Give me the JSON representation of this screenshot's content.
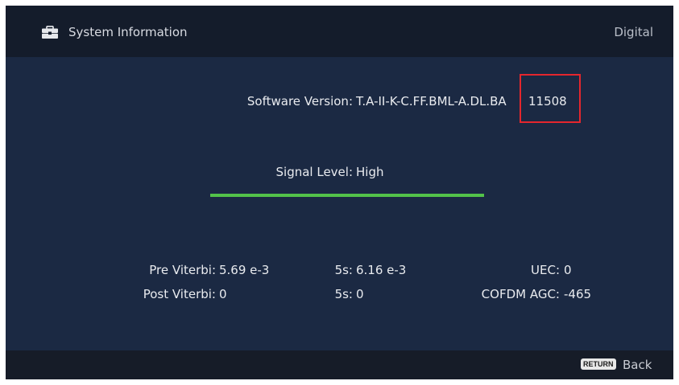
{
  "header": {
    "icon": "toolbox-icon",
    "title": "System Information",
    "mode": "Digital"
  },
  "software": {
    "label": "Software Version:",
    "value": "T.A-II-K-C.FF.BML-A.DL.BA",
    "build": "11508"
  },
  "signal": {
    "label": "Signal Level:",
    "value": "High",
    "level_percent": 100,
    "bar_color": "#52c24a"
  },
  "stats": {
    "pre_viterbi_label": "Pre Viterbi:",
    "pre_viterbi_value": "5.69 e-3",
    "pre_5s_label": "5s:",
    "pre_5s_value": "6.16 e-3",
    "uec_label": "UEC:",
    "uec_value": "0",
    "post_viterbi_label": "Post Viterbi:",
    "post_viterbi_value": "0",
    "post_5s_label": "5s:",
    "post_5s_value": "0",
    "cofdm_label": "COFDM AGC:",
    "cofdm_value": "-465"
  },
  "footer": {
    "return_key": "RETURN",
    "back_label": "Back"
  },
  "colors": {
    "highlight_box": "#e5262d",
    "background": "#1b2943"
  }
}
